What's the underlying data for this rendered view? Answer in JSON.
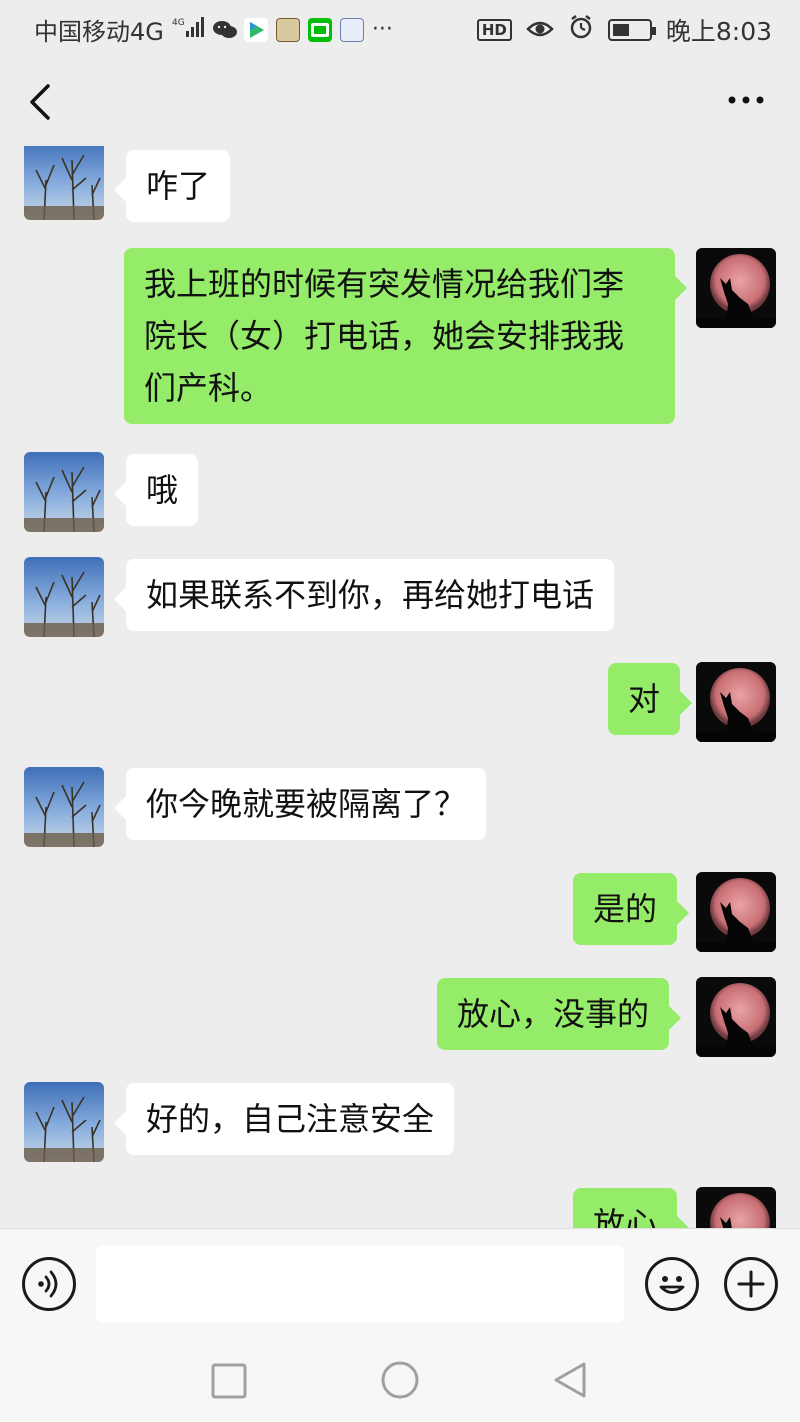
{
  "status_bar": {
    "carrier": "中国移动4G",
    "signal_label": "4G",
    "more_indicator": "···",
    "hd_badge": "HD",
    "time": "晚上8:03",
    "battery_level": 0.45
  },
  "colors": {
    "outgoing_bubble": "#95ec69",
    "incoming_bubble": "#ffffff",
    "background": "#ededed"
  },
  "nav": {
    "back_icon": "chevron-left-icon",
    "more_icon": "more-dots-icon"
  },
  "messages": [
    {
      "sender": "contact",
      "text": "咋了"
    },
    {
      "sender": "me",
      "text_lines": [
        "我上班的时候有突发情况给我们李",
        "院长（女）打电话，她会安排我我",
        "们产科。"
      ]
    },
    {
      "sender": "contact",
      "text": "哦"
    },
    {
      "sender": "contact",
      "text": "如果联系不到你，再给她打电话"
    },
    {
      "sender": "me",
      "text": "对"
    },
    {
      "sender": "contact",
      "text": "你今晚就要被隔离了？"
    },
    {
      "sender": "me",
      "text": "是的"
    },
    {
      "sender": "me",
      "text": "放心，没事的"
    },
    {
      "sender": "contact",
      "text": "好的，自己注意安全"
    },
    {
      "sender": "me",
      "text": "放心"
    }
  ],
  "input_bar": {
    "voice_icon": "voice-icon",
    "emoji_icon": "emoji-icon",
    "add_icon": "plus-icon",
    "value": ""
  },
  "system_nav": {
    "recents_icon": "square-icon",
    "home_icon": "circle-icon",
    "back_icon": "triangle-back-icon"
  }
}
